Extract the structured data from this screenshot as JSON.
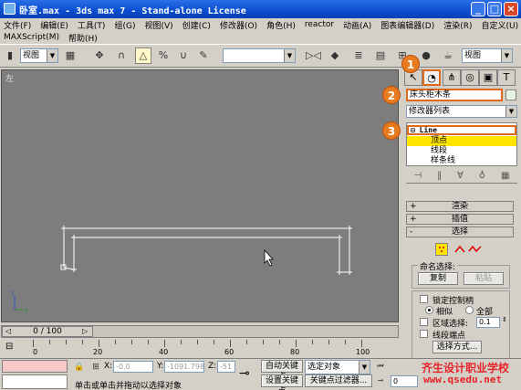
{
  "window": {
    "title": "卧室.max - 3ds max 7  - Stand-alone License",
    "minimize": "_",
    "maximize": "□",
    "close": "×"
  },
  "menubar": {
    "row1": [
      "文件(F)",
      "编辑(E)",
      "工具(T)",
      "组(G)",
      "视图(V)",
      "创建(C)",
      "修改器(O)",
      "角色(H)",
      "reactor",
      "动画(A)",
      "图表编辑器(D)",
      "渲染(R)",
      "自定义(U)"
    ],
    "row2": [
      "MAXScript(M)",
      "帮助(H)"
    ]
  },
  "toolbar": {
    "coord_dropdown": "视图",
    "selection_set": "",
    "viewport_dropdown": "视图"
  },
  "viewport": {
    "label": "左",
    "background": "#7d7d7d",
    "shape_color": "#ffffff"
  },
  "command_panel": {
    "badges": [
      "1",
      "2",
      "3"
    ],
    "object_name": "床头柜木条",
    "modifier_list": "修改器列表",
    "stack": {
      "base": "Line",
      "items": [
        "顶点",
        "线段",
        "样条线"
      ],
      "selected": "顶点"
    },
    "rollouts": {
      "render": "渲染",
      "interpolation": "插值",
      "selection": "选择"
    },
    "named_selection": {
      "caption": "命名选择:",
      "copy": "复制",
      "paste": "粘贴"
    },
    "lock_handles": "锁定控制柄",
    "similar": "相似",
    "all": "全部",
    "area_selection": "区域选择:",
    "area_value": "0.1",
    "segment_end": "线段端点",
    "select_by": "选择方式..."
  },
  "timeline": {
    "frame_display": "0 / 100",
    "ticks": [
      "0",
      "20",
      "40",
      "60",
      "80",
      "100"
    ]
  },
  "statusbar": {
    "prompt": "单击或单击并拖动以选择对象",
    "x_label": "X:",
    "x_value": "-0.0",
    "y_label": "Y:",
    "y_value": "-1091.798",
    "z_label": "Z:",
    "z_value": "-51",
    "auto_key": "自动关键点",
    "set_key": "设置关键点",
    "selected_object": "选定对象",
    "key_filter": "关键点过滤器...",
    "frame_value": "0"
  },
  "watermark": {
    "line1": "齐生设计职业学校",
    "line2": "www.qsedu.net"
  }
}
